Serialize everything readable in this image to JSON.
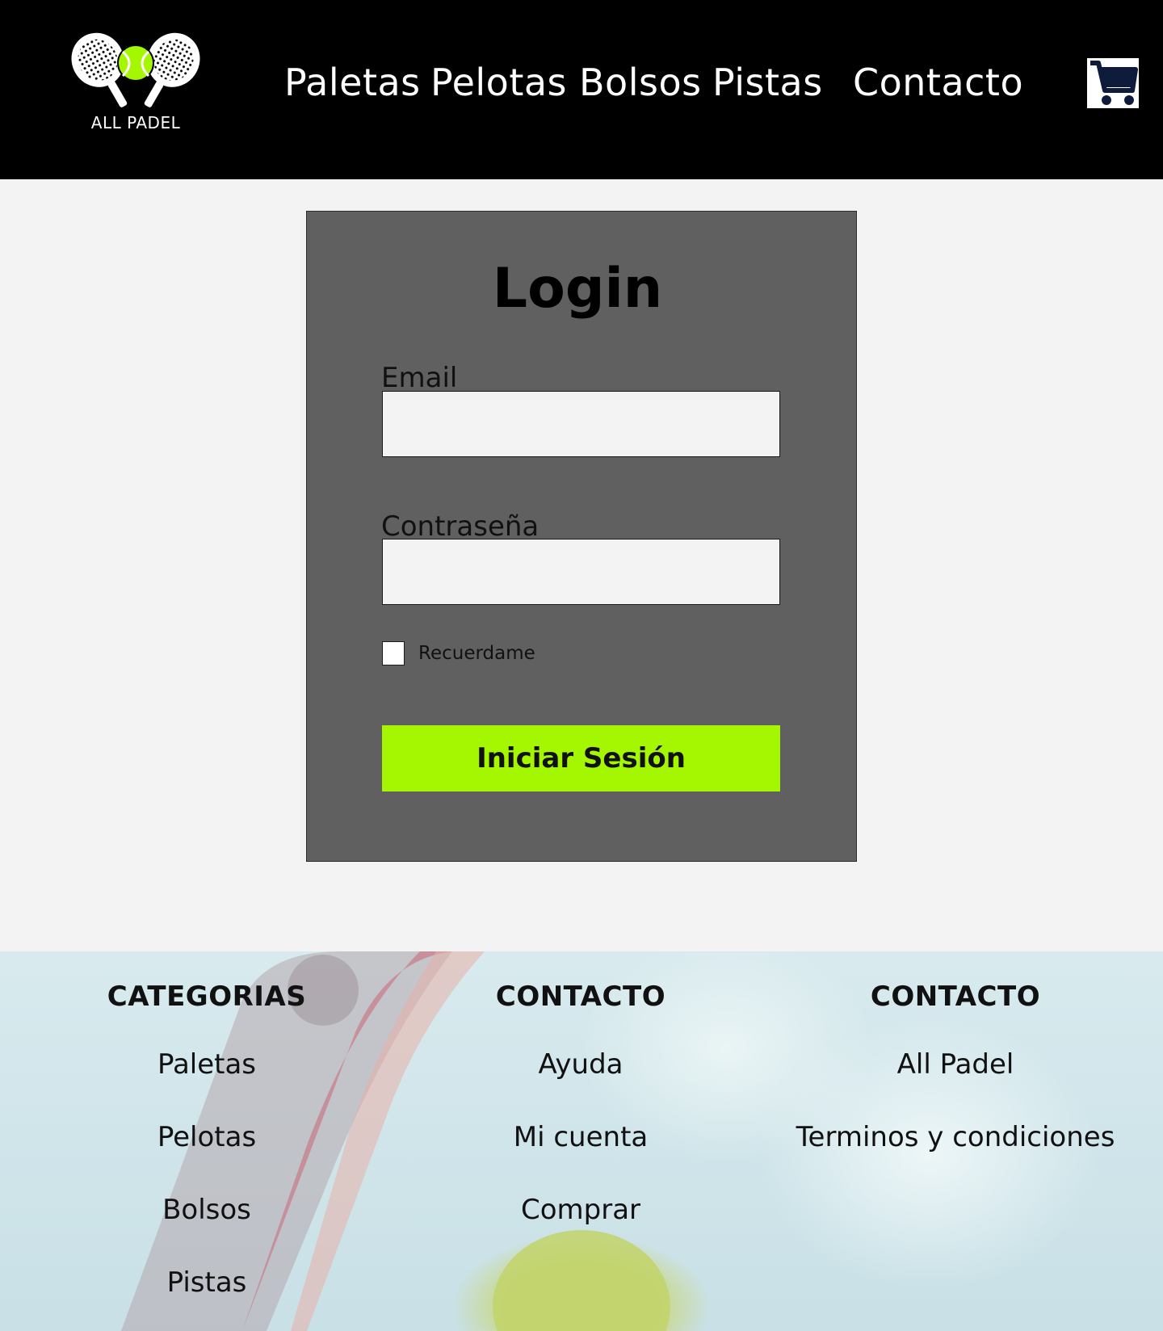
{
  "header": {
    "logo_text": "ALL PADEL",
    "nav": [
      "Paletas",
      "Pelotas",
      "Bolsos",
      "Pistas",
      "Contacto"
    ],
    "cart_icon": "shopping-cart-icon"
  },
  "login": {
    "title": "Login",
    "email_label": "Email",
    "email_value": "",
    "password_label": "Contraseña",
    "password_value": "",
    "remember_label": "Recuerdame",
    "remember_checked": false,
    "submit_label": "Iniciar Sesión"
  },
  "footer": {
    "columns": [
      {
        "heading": "CATEGORIAS",
        "links": [
          "Paletas",
          "Pelotas",
          "Bolsos",
          "Pistas"
        ]
      },
      {
        "heading": "CONTACTO",
        "links": [
          "Ayuda",
          "Mi cuenta",
          "Comprar"
        ]
      },
      {
        "heading": "CONTACTO",
        "links": [
          "All Padel",
          "Terminos y condiciones"
        ]
      }
    ]
  },
  "colors": {
    "header_bg": "#000000",
    "page_bg": "#f3f3f3",
    "card_bg": "#606060",
    "accent": "#a4f700",
    "cart_icon": "#0e1b3a"
  }
}
